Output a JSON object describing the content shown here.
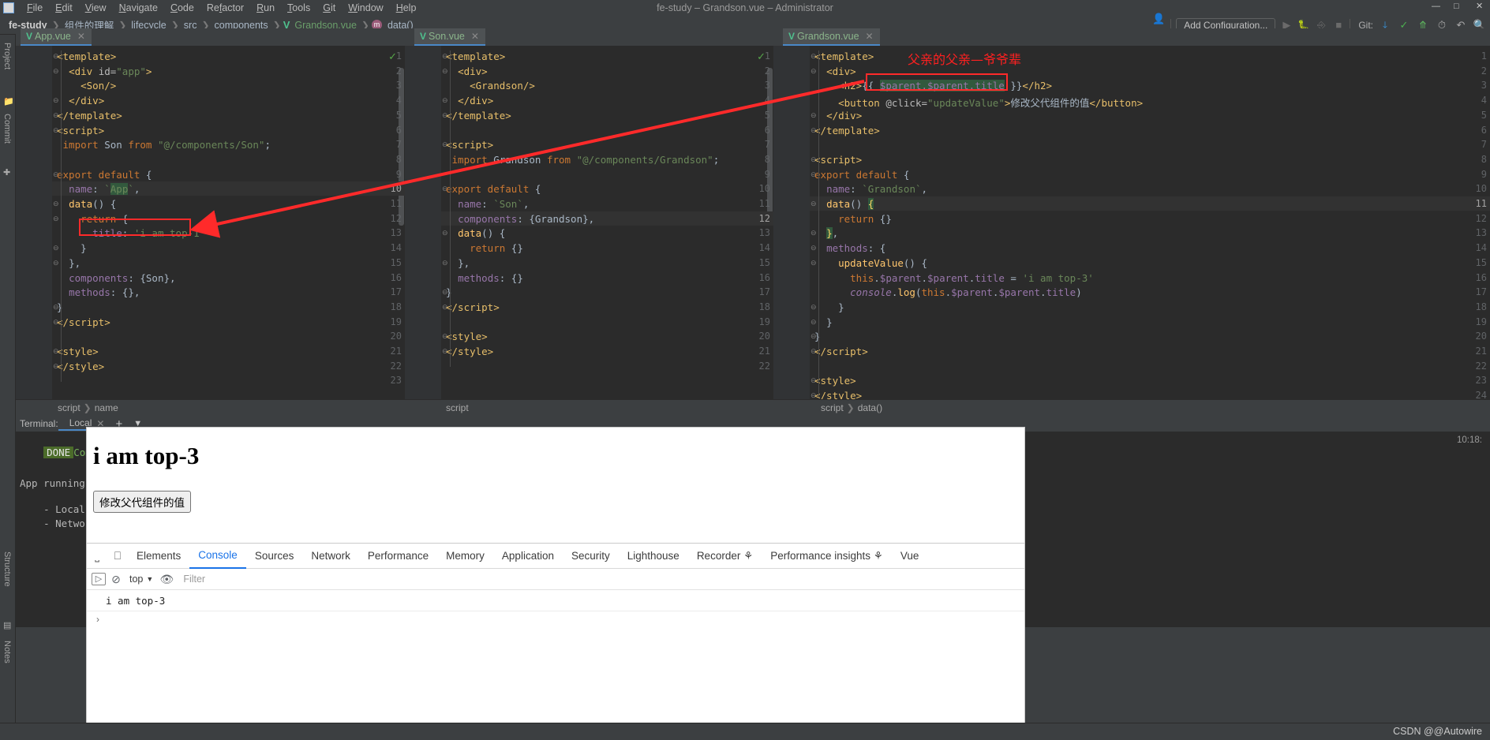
{
  "window": {
    "title": "fe-study – Grandson.vue – Administrator",
    "app_name": "fe-study",
    "menu": [
      "File",
      "Edit",
      "View",
      "Navigate",
      "Code",
      "Refactor",
      "Run",
      "Tools",
      "Git",
      "Window",
      "Help"
    ]
  },
  "breadcrumbs": [
    {
      "label": "fe-study",
      "style": "bold"
    },
    {
      "label": "组件的理解",
      "style": "plain"
    },
    {
      "label": "lifecycle",
      "style": "plain"
    },
    {
      "label": "src",
      "style": "plain"
    },
    {
      "label": "components",
      "style": "plain"
    },
    {
      "label": "Grandson.vue",
      "style": "vue"
    },
    {
      "label": "data()",
      "style": "method"
    }
  ],
  "toolbar": {
    "add_configuration": "Add Configuration...",
    "git_label": "Git:",
    "icons": [
      "user-dropdown-icon",
      "run-icon",
      "debug-icon",
      "coverage-icon",
      "stop-icon",
      "git-update-icon",
      "git-commit-icon",
      "git-push-icon",
      "history-icon",
      "undo-icon",
      "search-icon"
    ]
  },
  "left_rail": {
    "items": [
      "Project",
      "Commit",
      "Structure",
      "Notes"
    ]
  },
  "editors": [
    {
      "tab": "App.vue",
      "breadcrumb": [
        "script",
        "name"
      ],
      "current_line": 10,
      "inspection_ok": true,
      "lines": [
        {
          "n": 1,
          "fold": "open",
          "html": "<span class='tag'>&lt;template&gt;</span>"
        },
        {
          "n": 2,
          "fold": "open",
          "html": "  <span class='tag'>&lt;div</span> <span class='attr'>id=</span><span class='str'>\"app\"</span><span class='tag'>&gt;</span>"
        },
        {
          "n": 3,
          "fold": "",
          "html": "    <span class='tag'>&lt;Son/&gt;</span>"
        },
        {
          "n": 4,
          "fold": "close",
          "html": "  <span class='tag'>&lt;/div&gt;</span>"
        },
        {
          "n": 5,
          "fold": "close",
          "html": "<span class='tag'>&lt;/template&gt;</span>"
        },
        {
          "n": 6,
          "fold": "open",
          "html": "<span class='tag'>&lt;script&gt;</span>"
        },
        {
          "n": 7,
          "fold": "",
          "html": " <span class='kw'>import</span> <span class='pl'>Son</span> <span class='kw'>from</span> <span class='str'>\"@/components/Son\"</span><span class='pl'>;</span>"
        },
        {
          "n": 8,
          "fold": "",
          "html": ""
        },
        {
          "n": 9,
          "fold": "open",
          "html": "<span class='kw'>export default</span> <span class='pl'>{</span>"
        },
        {
          "n": 10,
          "fold": "",
          "html": "  <span class='fld'>name</span><span class='pl'>: </span><span class='str'>`</span><span class='str sel-green'>App</span><span class='str'>`</span><span class='pl'>,</span>"
        },
        {
          "n": 11,
          "fold": "open",
          "html": "  <span class='fn'>data</span><span class='pl'>() {</span>"
        },
        {
          "n": 12,
          "fold": "open",
          "html": "    <span class='kw'>return</span> <span class='pl'>{</span>"
        },
        {
          "n": 13,
          "fold": "",
          "html": "      <span class='fld'>title</span><span class='pl'>: </span><span class='str'>'i am top-1'</span>"
        },
        {
          "n": 14,
          "fold": "close",
          "html": "    <span class='pl'>}</span>"
        },
        {
          "n": 15,
          "fold": "close",
          "html": "  <span class='pl'>},</span>"
        },
        {
          "n": 16,
          "fold": "",
          "html": "  <span class='fld'>components</span><span class='pl'>: {Son},</span>"
        },
        {
          "n": 17,
          "fold": "",
          "html": "  <span class='fld'>methods</span><span class='pl'>: {},</span>"
        },
        {
          "n": 18,
          "fold": "close",
          "html": "<span class='pl'>}</span>"
        },
        {
          "n": 19,
          "fold": "close",
          "html": "<span class='tag'>&lt;/script&gt;</span>"
        },
        {
          "n": 20,
          "fold": "",
          "html": ""
        },
        {
          "n": 21,
          "fold": "open",
          "html": "<span class='tag'>&lt;style&gt;</span>"
        },
        {
          "n": 22,
          "fold": "close",
          "html": "<span class='tag'>&lt;/style&gt;</span>"
        },
        {
          "n": 23,
          "fold": "",
          "html": ""
        }
      ]
    },
    {
      "tab": "Son.vue",
      "breadcrumb": [
        "script"
      ],
      "current_line": 12,
      "inspection_ok": true,
      "lines": [
        {
          "n": 1,
          "fold": "open",
          "html": "<span class='tag'>&lt;template&gt;</span>"
        },
        {
          "n": 2,
          "fold": "open",
          "html": "  <span class='tag'>&lt;div&gt;</span>"
        },
        {
          "n": 3,
          "fold": "",
          "html": "    <span class='tag'>&lt;Grandson/&gt;</span>"
        },
        {
          "n": 4,
          "fold": "close",
          "html": "  <span class='tag'>&lt;/div&gt;</span>"
        },
        {
          "n": 5,
          "fold": "close",
          "html": "<span class='tag'>&lt;/template&gt;</span>"
        },
        {
          "n": 6,
          "fold": "",
          "html": ""
        },
        {
          "n": 7,
          "fold": "open",
          "html": "<span class='tag'>&lt;script&gt;</span>"
        },
        {
          "n": 8,
          "fold": "",
          "html": " <span class='kw'>import</span> <span class='pl'>Grandson</span> <span class='kw'>from</span> <span class='str'>\"@/components/Grandson\"</span><span class='pl'>;</span>"
        },
        {
          "n": 9,
          "fold": "",
          "html": ""
        },
        {
          "n": 10,
          "fold": "open",
          "html": "<span class='kw'>export default</span> <span class='pl'>{</span>"
        },
        {
          "n": 11,
          "fold": "",
          "html": "  <span class='fld'>name</span><span class='pl'>: </span><span class='str'>`Son`</span><span class='pl'>,</span>"
        },
        {
          "n": 12,
          "fold": "",
          "html": "  <span class='fld'>components</span><span class='pl'>: {Grandson},</span>"
        },
        {
          "n": 13,
          "fold": "open",
          "html": "  <span class='fn'>data</span><span class='pl'>() {</span>"
        },
        {
          "n": 14,
          "fold": "",
          "html": "    <span class='kw'>return</span> <span class='pl'>{}</span>"
        },
        {
          "n": 15,
          "fold": "close",
          "html": "  <span class='pl'>},</span>"
        },
        {
          "n": 16,
          "fold": "",
          "html": "  <span class='fld'>methods</span><span class='pl'>: {}</span>"
        },
        {
          "n": 17,
          "fold": "close",
          "html": "<span class='pl'>}</span>"
        },
        {
          "n": 18,
          "fold": "close",
          "html": "<span class='tag'>&lt;/script&gt;</span>"
        },
        {
          "n": 19,
          "fold": "",
          "html": ""
        },
        {
          "n": 20,
          "fold": "open",
          "html": "<span class='tag'>&lt;style&gt;</span>"
        },
        {
          "n": 21,
          "fold": "close",
          "html": "<span class='tag'>&lt;/style&gt;</span>"
        },
        {
          "n": 22,
          "fold": "",
          "html": ""
        }
      ]
    },
    {
      "tab": "Grandson.vue",
      "breadcrumb": [
        "script",
        "data()"
      ],
      "current_line": 11,
      "inspection_ok": true,
      "lines": [
        {
          "n": 1,
          "fold": "open",
          "html": "<span class='tag'>&lt;template&gt;</span>"
        },
        {
          "n": 2,
          "fold": "open",
          "html": "  <span class='tag'>&lt;div&gt;</span>"
        },
        {
          "n": 3,
          "fold": "",
          "html": "    <span class='tag'>&lt;h2&gt;</span><span class='pl'>{{ </span><span class='fld sel-green'>$parent.$parent.title</span><span class='pl'> }}</span><span class='tag'>&lt;/h2&gt;</span>"
        },
        {
          "n": 4,
          "fold": "",
          "html": "    <span class='tag'>&lt;button</span> <span class='attr'>@click=</span><span class='str'>\"updateValue\"</span><span class='tag'>&gt;</span><span class='pl'>修改父代组件的值</span><span class='tag'>&lt;/button&gt;</span>"
        },
        {
          "n": 5,
          "fold": "close",
          "html": "  <span class='tag'>&lt;/div&gt;</span>"
        },
        {
          "n": 6,
          "fold": "close",
          "html": "<span class='tag'>&lt;/template&gt;</span>"
        },
        {
          "n": 7,
          "fold": "",
          "html": ""
        },
        {
          "n": 8,
          "fold": "open",
          "html": "<span class='tag'>&lt;script&gt;</span>"
        },
        {
          "n": 9,
          "fold": "open",
          "html": "<span class='kw'>export default</span> <span class='pl'>{</span>"
        },
        {
          "n": 10,
          "fold": "",
          "html": "  <span class='fld'>name</span><span class='pl'>: </span><span class='str'>`Grandson`</span><span class='pl'>,</span>"
        },
        {
          "n": 11,
          "fold": "open",
          "html": "  <span class='fn'>data</span><span class='pl'>() </span><span class='pl sel-green' style='color:#ffd866'>{</span>"
        },
        {
          "n": 12,
          "fold": "",
          "html": "    <span class='kw'>return</span> <span class='pl'>{}</span>"
        },
        {
          "n": 13,
          "fold": "close",
          "html": "  <span class='pl sel-green' style='color:#ffd866'>}</span><span class='pl'>,</span>"
        },
        {
          "n": 14,
          "fold": "open",
          "html": "  <span class='fld'>methods</span><span class='pl'>: {</span>"
        },
        {
          "n": 15,
          "fold": "open",
          "html": "    <span class='fn'>updateValue</span><span class='pl'>() {</span>"
        },
        {
          "n": 16,
          "fold": "",
          "html": "      <span class='kw'>this</span><span class='pl'>.</span><span class='fld'>$parent</span><span class='pl'>.</span><span class='fld'>$parent</span><span class='pl'>.</span><span class='fld'>title</span> <span class='pl'>= </span><span class='str'>'i am top-3'</span>"
        },
        {
          "n": 17,
          "fold": "",
          "html": "      <span class='com' style='font-style:italic;color:#9876aa'>console</span><span class='pl'>.</span><span class='fn'>log</span><span class='pl'>(</span><span class='kw'>this</span><span class='pl'>.</span><span class='fld'>$parent</span><span class='pl'>.</span><span class='fld'>$parent</span><span class='pl'>.</span><span class='fld'>title</span><span class='pl'>)</span>"
        },
        {
          "n": 18,
          "fold": "close",
          "html": "    <span class='pl'>}</span>"
        },
        {
          "n": 19,
          "fold": "close",
          "html": "  <span class='pl'>}</span>"
        },
        {
          "n": 20,
          "fold": "close",
          "html": "<span class='pl'>}</span>"
        },
        {
          "n": 21,
          "fold": "close",
          "html": "<span class='tag'>&lt;/script&gt;</span>"
        },
        {
          "n": 22,
          "fold": "",
          "html": ""
        },
        {
          "n": 23,
          "fold": "open",
          "html": "<span class='tag'>&lt;style&gt;</span>"
        },
        {
          "n": 24,
          "fold": "close",
          "html": "<span class='tag'>&lt;/style&gt;</span>"
        }
      ]
    }
  ],
  "annotation": {
    "note_text": "父亲的父亲—爷爷辈",
    "note_color": "#ff2020",
    "box_color": "#ff2a2a"
  },
  "terminal": {
    "label": "Terminal:",
    "tab": "Local",
    "add_icon": "plus-icon",
    "dropdown_icon": "chevron-down-icon",
    "badge": "DONE",
    "badge_text": "Compile",
    "lines": [
      "App running",
      "- Local:   h",
      "- Network: h"
    ],
    "clock": "10:18:"
  },
  "browser": {
    "heading": "i am top-3",
    "button_label": "修改父代组件的值"
  },
  "devtools": {
    "icons": [
      "inspect-element-icon",
      "device-toolbar-icon"
    ],
    "tabs": [
      "Elements",
      "Console",
      "Sources",
      "Network",
      "Performance",
      "Memory",
      "Application",
      "Security",
      "Lighthouse",
      "Recorder",
      "Performance insights",
      "Vue"
    ],
    "selected_tab": "Console",
    "tabs_with_badge": [
      "Recorder",
      "Performance insights"
    ],
    "toolbar": {
      "execute_icon": "execute-icon",
      "clear_icon": "clear-console-icon",
      "context": "top",
      "context_caret": "chevron-down-icon",
      "eye_icon": "live-expression-icon",
      "filter_placeholder": "Filter"
    },
    "console_output": [
      "i am top-3"
    ],
    "prompt_caret": "›"
  },
  "status_bar": {
    "watermark": "CSDN @@Autowire"
  }
}
